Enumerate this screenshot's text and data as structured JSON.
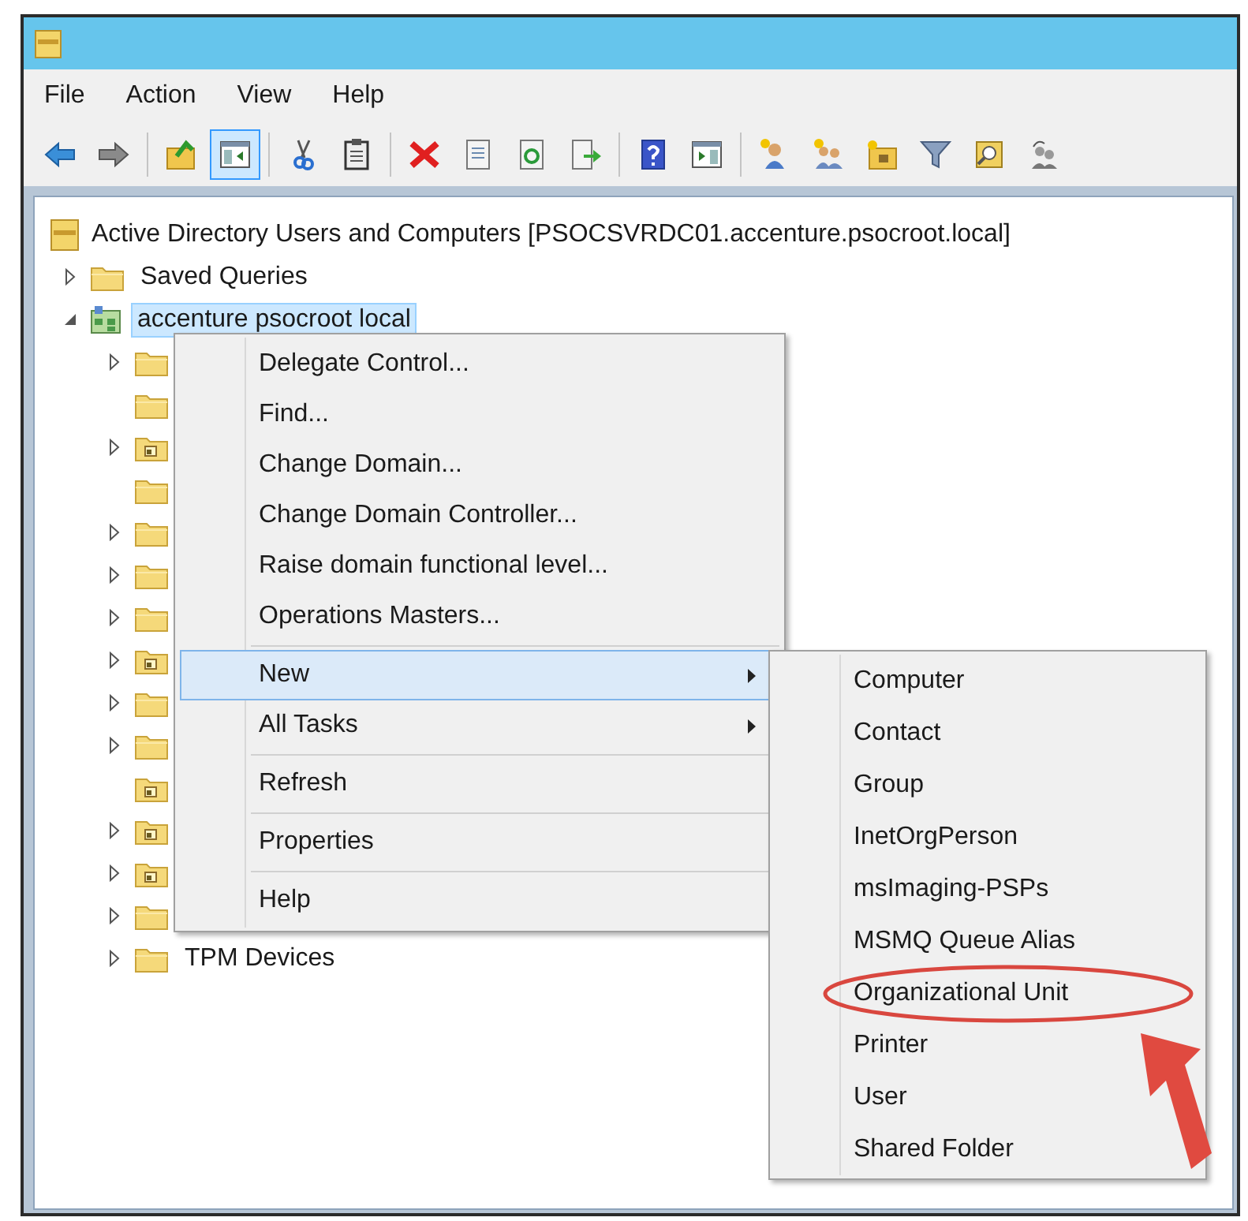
{
  "menu_bar": [
    "File",
    "Action",
    "View",
    "Help"
  ],
  "toolbar_buttons": [
    {
      "pressed": false
    },
    {
      "pressed": false
    },
    {
      "pressed": false
    },
    {
      "pressed": true
    },
    {
      "pressed": false
    },
    {
      "pressed": false
    },
    {
      "pressed": false
    },
    {
      "pressed": false
    },
    {
      "pressed": false
    },
    {
      "pressed": false
    },
    {
      "pressed": false
    },
    {
      "pressed": false
    },
    {
      "pressed": false
    },
    {
      "pressed": false
    },
    {
      "pressed": false
    },
    {
      "pressed": false
    },
    {
      "pressed": false
    },
    {
      "pressed": false
    }
  ],
  "tree": {
    "label": "Active Directory Users and Computers [PSOCSVRDC01.accenture.psocroot.local]",
    "children": [
      {
        "label": "Saved Queries",
        "kind": "folder",
        "expanded": false,
        "has_children": true,
        "selected": false
      },
      {
        "label": "accenture psocroot local",
        "kind": "domain",
        "expanded": true,
        "has_children": true,
        "selected": true,
        "children": [
          {
            "kind": "folder",
            "has_children": true
          },
          {
            "kind": "folder",
            "has_children": false
          },
          {
            "kind": "container",
            "has_children": true
          },
          {
            "kind": "folder",
            "has_children": false
          },
          {
            "kind": "folder",
            "has_children": true
          },
          {
            "kind": "folder",
            "has_children": true
          },
          {
            "kind": "folder",
            "has_children": true
          },
          {
            "kind": "container",
            "has_children": true
          },
          {
            "kind": "folder",
            "has_children": true
          },
          {
            "kind": "folder",
            "has_children": true
          },
          {
            "kind": "container",
            "has_children": false
          },
          {
            "kind": "container",
            "has_children": true
          },
          {
            "kind": "container",
            "has_children": true
          },
          {
            "kind": "folder",
            "has_children": true
          },
          {
            "label": "TPM Devices",
            "kind": "folder",
            "has_children": true
          }
        ]
      }
    ]
  },
  "context_menu": [
    {
      "kind": "item",
      "label": "Delegate Control...",
      "selected": false,
      "has_submenu": false
    },
    {
      "kind": "item",
      "label": "Find...",
      "selected": false,
      "has_submenu": false
    },
    {
      "kind": "item",
      "label": "Change Domain...",
      "selected": false,
      "has_submenu": false
    },
    {
      "kind": "item",
      "label": "Change Domain Controller...",
      "selected": false,
      "has_submenu": false
    },
    {
      "kind": "item",
      "label": "Raise domain functional level...",
      "selected": false,
      "has_submenu": false
    },
    {
      "kind": "item",
      "label": "Operations Masters...",
      "selected": false,
      "has_submenu": false
    },
    {
      "kind": "separator"
    },
    {
      "kind": "item",
      "label": "New",
      "selected": true,
      "has_submenu": true
    },
    {
      "kind": "item",
      "label": "All Tasks",
      "selected": false,
      "has_submenu": true
    },
    {
      "kind": "separator"
    },
    {
      "kind": "item",
      "label": "Refresh",
      "selected": false,
      "has_submenu": false
    },
    {
      "kind": "separator"
    },
    {
      "kind": "item",
      "label": "Properties",
      "selected": false,
      "has_submenu": false
    },
    {
      "kind": "separator"
    },
    {
      "kind": "item",
      "label": "Help",
      "selected": false,
      "has_submenu": false
    }
  ],
  "submenu": [
    {
      "label": "Computer",
      "circled": false
    },
    {
      "label": "Contact",
      "circled": false
    },
    {
      "label": "Group",
      "circled": false
    },
    {
      "label": "InetOrgPerson",
      "circled": false
    },
    {
      "label": "msImaging-PSPs",
      "circled": false
    },
    {
      "label": "MSMQ Queue Alias",
      "circled": false
    },
    {
      "label": "Organizational Unit",
      "circled": true
    },
    {
      "label": "Printer",
      "circled": false
    },
    {
      "label": "User",
      "circled": false
    },
    {
      "label": "Shared Folder",
      "circled": false
    }
  ]
}
